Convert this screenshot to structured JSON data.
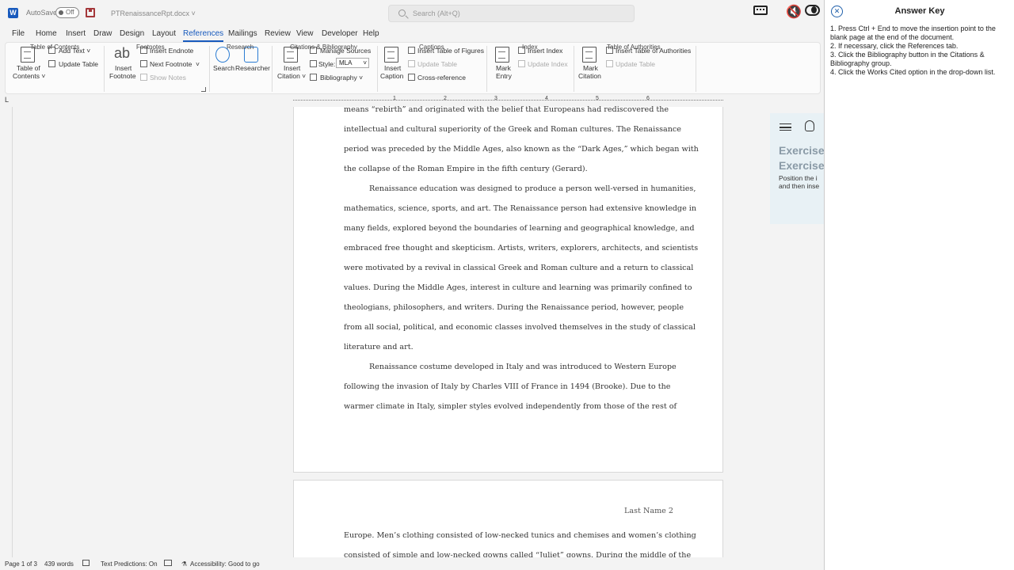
{
  "titlebar": {
    "app_letter": "W",
    "autosave_label": "AutoSave",
    "autosave_state": "Off",
    "document_name": "PTRenaissanceRpt.docx ˅",
    "search_placeholder": "Search (Alt+Q)",
    "mute_glyph": "🔇"
  },
  "menu": {
    "tabs": [
      "File",
      "Home",
      "Insert",
      "Draw",
      "Design",
      "Layout",
      "References",
      "Mailings",
      "Review",
      "View",
      "Developer",
      "Help"
    ],
    "active": "References"
  },
  "ribbon": {
    "toc": {
      "btn_line1": "Table of",
      "btn_line2": "Contents ˅",
      "add_text": "Add Text ˅",
      "update_table": "Update Table",
      "group": "Table of Contents"
    },
    "footnotes": {
      "insert_footnote_line1": "Insert",
      "insert_footnote_line2": "Footnote",
      "insert_endnote": "Insert Endnote",
      "next_footnote": "Next Footnote",
      "next_footnote_arrow": "˅",
      "show_notes": "Show Notes",
      "group": "Footnotes"
    },
    "research": {
      "search": "Search",
      "researcher": "Researcher",
      "group": "Research"
    },
    "citations": {
      "insert_citation_line1": "Insert",
      "insert_citation_line2": "Citation ˅",
      "manage_sources": "Manage Sources",
      "style_label": "Style:",
      "style_value": "MLA",
      "bibliography": "Bibliography ˅",
      "group": "Citations & Bibliography"
    },
    "captions": {
      "insert_caption_line1": "Insert",
      "insert_caption_line2": "Caption",
      "insert_table_of_figures": "Insert Table of Figures",
      "update_table": "Update Table",
      "cross_reference": "Cross-reference",
      "group": "Captions"
    },
    "index": {
      "mark_entry_line1": "Mark",
      "mark_entry_line2": "Entry",
      "insert_index": "Insert Index",
      "update_index": "Update Index",
      "group": "Index"
    },
    "authorities": {
      "mark_citation_line1": "Mark",
      "mark_citation_line2": "Citation",
      "insert_table": "Insert Table of Authorities",
      "update_table": "Update Table",
      "group": "Table of Authorities"
    }
  },
  "ruler": {
    "corner": "L",
    "numbers": [
      "1",
      "2",
      "3",
      "4",
      "5",
      "6"
    ]
  },
  "document": {
    "page1_lines": [
      "means “rebirth” and originated with the belief that Europeans had rediscovered the",
      "intellectual and cultural superiority of the Greek and Roman cultures. The Renaissance",
      "period was preceded by the Middle Ages, also known as the “Dark Ages,” which began with",
      "the collapse of the Roman Empire in the fifth century (Gerard).",
      "Renaissance education was designed to produce a person well-versed in humanities,",
      "mathematics, science, sports, and art. The Renaissance person had extensive knowledge in",
      "many fields, explored beyond the boundaries of learning and geographical knowledge, and",
      "embraced free thought and skepticism. Artists, writers, explorers, architects, and scientists",
      "were motivated by a revival in classical Greek and Roman culture and a return to classical",
      "values. During the Middle Ages, interest in culture and learning was primarily confined to",
      "theologians, philosophers, and writers. During the Renaissance period, however, people",
      "from all social, political, and economic classes involved themselves in the study of classical",
      "literature and art.",
      "Renaissance costume developed in Italy and was introduced to Western Europe",
      "following the invasion of Italy by Charles VIII of France in 1494 (Brooke). Due to the",
      "warmer climate in Italy, simpler styles evolved independently from those of the rest of"
    ],
    "page2_header": "Last Name 2",
    "page2_lines": [
      "Europe. Men’s clothing consisted of low-necked tunics and chemises and women’s clothing",
      "consisted of simple and low-necked gowns called “Juliet” gowns. During the middle of the"
    ]
  },
  "exercise_panel": {
    "title1": "Exercise",
    "title2": "Exercise",
    "text1": "Position the i",
    "text2": "and then inse"
  },
  "statusbar": {
    "page": "Page 1 of 3",
    "words": "439 words",
    "text_predictions": "Text Predictions: On",
    "accessibility": "Accessibility: Good to go"
  },
  "answer_key": {
    "close_glyph": "✕",
    "title": "Answer Key",
    "steps": [
      "1. Press Ctrl + End to move the insertion point to the blank page at the end of the document.",
      "2. If necessary, click the References tab.",
      "3. Click the Bibliography button in the Citations & Bibliography group.",
      "4. Click the Works Cited option in the drop-down list."
    ]
  }
}
